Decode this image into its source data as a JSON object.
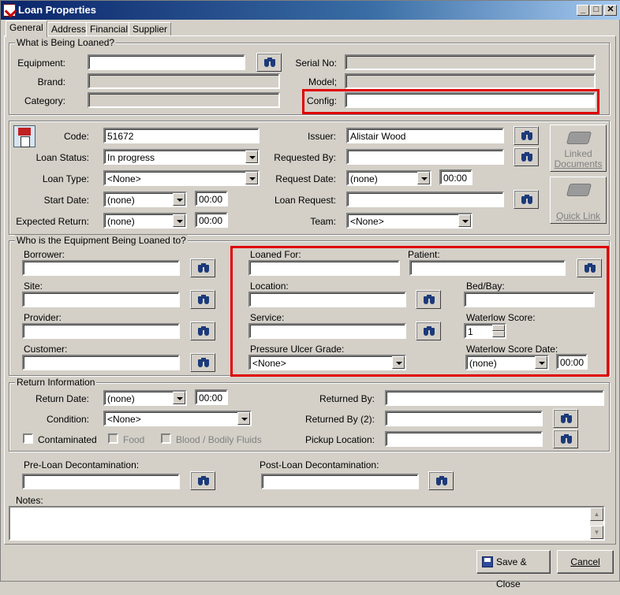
{
  "window": {
    "title": "Loan Properties",
    "minimize": "_",
    "maximize": "□",
    "close": "✕"
  },
  "tabs": [
    "General",
    "Address",
    "Financial",
    "Supplier"
  ],
  "what": {
    "legend": "What is Being Loaned?",
    "equipment_label": "Equipment:",
    "equipment_value": "",
    "brand_label": "Brand:",
    "brand_value": "",
    "category_label": "Category:",
    "category_value": "",
    "serial_label": "Serial No:",
    "serial_value": "",
    "model_label": "Model;",
    "model_value": "",
    "config_label": "Config:",
    "config_value": ""
  },
  "loan": {
    "code_label": "Code:",
    "code_value": "51672",
    "status_label": "Loan Status:",
    "status_value": "In progress",
    "type_label": "Loan Type:",
    "type_value": "<None>",
    "start_label": "Start Date:",
    "start_date": "(none)",
    "start_time": "00:00",
    "expected_label": "Expected Return:",
    "expected_date": "(none)",
    "expected_time": "00:00",
    "issuer_label": "Issuer:",
    "issuer_value": "Alistair Wood",
    "requested_by_label": "Requested By:",
    "requested_by_value": "",
    "request_date_label": "Request Date:",
    "request_date_value": "(none)",
    "request_time": "00:00",
    "loan_request_label": "Loan Request:",
    "loan_request_value": "",
    "team_label": "Team:",
    "team_value": "<None>",
    "linked_documents": [
      "Linked",
      "Documents"
    ],
    "quick_link": "Quick Link"
  },
  "who": {
    "legend": "Who is the Equipment Being Loaned to?",
    "borrower_label": "Borrower:",
    "site_label": "Site:",
    "provider_label": "Provider:",
    "customer_label": "Customer:",
    "loaned_for_label": "Loaned For:",
    "patient_label": "Patient:",
    "location_label": "Location:",
    "bed_label": "Bed/Bay:",
    "service_label": "Service:",
    "waterlow_label": "Waterlow Score:",
    "waterlow_value": "1",
    "pressure_label": "Pressure Ulcer Grade:",
    "pressure_value": "<None>",
    "waterlow_date_label": "Waterlow Score Date:",
    "waterlow_date": "(none)",
    "waterlow_time": "00:00"
  },
  "ret": {
    "legend": "Return Information",
    "return_date_label": "Return Date:",
    "return_date": "(none)",
    "return_time": "00:00",
    "condition_label": "Condition:",
    "condition_value": "<None>",
    "contaminated": "Contaminated",
    "food": "Food",
    "blood": "Blood / Bodily Fluids",
    "returned_by_label": "Returned By:",
    "returned_by2_label": "Returned By (2):",
    "pickup_label": "Pickup Location:"
  },
  "decon": {
    "pre_label": "Pre-Loan Decontamination:",
    "post_label": "Post-Loan Decontamination:"
  },
  "notes": {
    "label": "Notes:",
    "value": ""
  },
  "buttons": {
    "save": "Save & Close",
    "cancel": "Cancel"
  },
  "colors": {
    "highlight": "#e00000",
    "titlebar": "#0a246a"
  }
}
